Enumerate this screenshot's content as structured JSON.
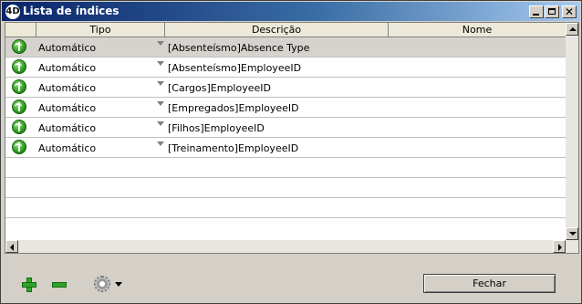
{
  "window": {
    "title": "Lista de índices"
  },
  "columns": [
    "Tipo",
    "Descrição",
    "Nome"
  ],
  "rows": [
    {
      "tipo": "Automático",
      "descricao": "[Absenteísmo]Absence Type",
      "nome": ""
    },
    {
      "tipo": "Automático",
      "descricao": "[Absenteísmo]EmployeeID",
      "nome": ""
    },
    {
      "tipo": "Automático",
      "descricao": "[Cargos]EmployeeID",
      "nome": ""
    },
    {
      "tipo": "Automático",
      "descricao": "[Empregados]EmployeeID",
      "nome": ""
    },
    {
      "tipo": "Automático",
      "descricao": "[Filhos]EmployeeID",
      "nome": ""
    },
    {
      "tipo": "Automático",
      "descricao": "[Treinamento]EmployeeID",
      "nome": ""
    }
  ],
  "footer": {
    "close_label": "Fechar"
  },
  "icons": {
    "add": "plus-icon",
    "remove": "minus-icon",
    "options": "gear-icon",
    "status": "index-status-icon"
  },
  "colors": {
    "accent_green": "#2fa32a",
    "title_blue": "#0a246a"
  }
}
